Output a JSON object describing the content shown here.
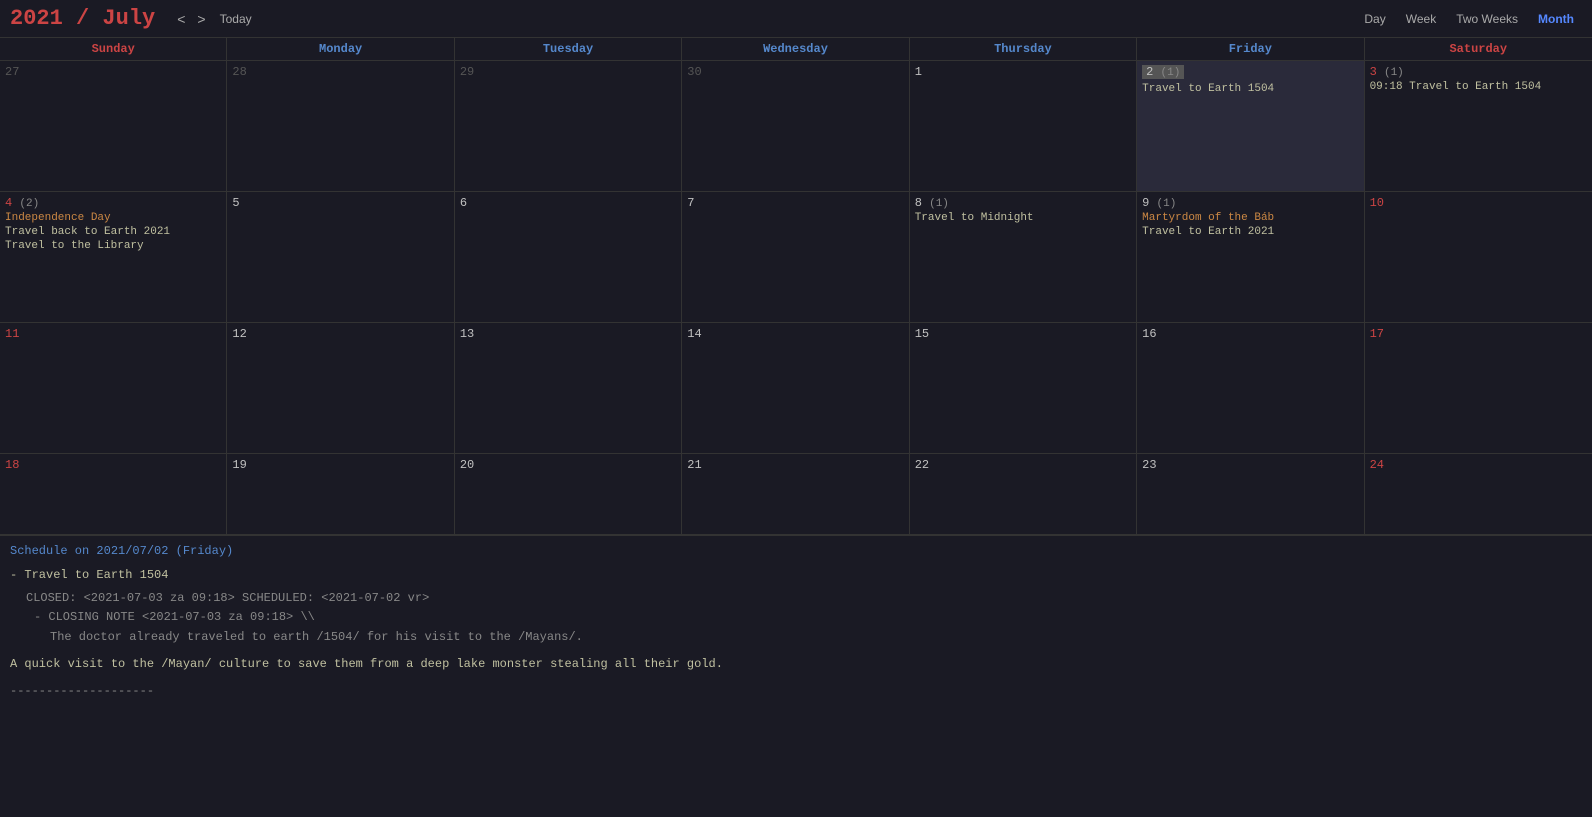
{
  "header": {
    "year": "2021",
    "slash": " / ",
    "month": "July",
    "nav_prev": "<",
    "nav_next": ">",
    "today_label": "Today",
    "views": [
      "Day",
      "Week",
      "Two Weeks",
      "Month"
    ],
    "active_view": "Month"
  },
  "day_headers": [
    {
      "label": "Sunday",
      "type": "sun"
    },
    {
      "label": "Monday",
      "type": "weekday"
    },
    {
      "label": "Tuesday",
      "type": "weekday"
    },
    {
      "label": "Wednesday",
      "type": "weekday"
    },
    {
      "label": "Thursday",
      "type": "weekday"
    },
    {
      "label": "Friday",
      "type": "weekday"
    },
    {
      "label": "Saturday",
      "type": "sat"
    }
  ],
  "weeks": [
    {
      "days": [
        {
          "num": "27",
          "badge": "",
          "type": "other",
          "events": []
        },
        {
          "num": "28",
          "badge": "",
          "type": "other",
          "events": []
        },
        {
          "num": "29",
          "badge": "",
          "type": "other",
          "events": []
        },
        {
          "num": "30",
          "badge": "",
          "type": "other",
          "events": []
        },
        {
          "num": "1",
          "badge": "",
          "type": "normal",
          "events": []
        },
        {
          "num": "2",
          "badge": "(1)",
          "type": "today",
          "events": [
            {
              "text": "Travel to Earth 1504",
              "style": "travel"
            }
          ]
        },
        {
          "num": "3",
          "badge": "(1)",
          "type": "saturday",
          "events": [
            {
              "text": "09:18 Travel to Earth 1504",
              "style": "travel"
            }
          ]
        }
      ]
    },
    {
      "days": [
        {
          "num": "4",
          "badge": "(2)",
          "type": "sunday",
          "events": [
            {
              "text": "Independence Day",
              "style": "holiday"
            },
            {
              "text": "Travel back to Earth 2021",
              "style": "travel"
            },
            {
              "text": "Travel to the Library",
              "style": "travel"
            }
          ]
        },
        {
          "num": "5",
          "badge": "",
          "type": "normal",
          "events": []
        },
        {
          "num": "6",
          "badge": "",
          "type": "normal",
          "events": []
        },
        {
          "num": "7",
          "badge": "",
          "type": "normal",
          "events": []
        },
        {
          "num": "8",
          "badge": "(1)",
          "type": "normal",
          "events": [
            {
              "text": "Travel to Midnight",
              "style": "travel"
            }
          ]
        },
        {
          "num": "9",
          "badge": "(1)",
          "type": "normal",
          "events": [
            {
              "text": "Martyrdom of the Báb",
              "style": "holiday"
            },
            {
              "text": "Travel to Earth 2021",
              "style": "travel"
            }
          ]
        },
        {
          "num": "10",
          "badge": "",
          "type": "saturday",
          "events": []
        }
      ]
    },
    {
      "days": [
        {
          "num": "11",
          "badge": "",
          "type": "sunday",
          "events": []
        },
        {
          "num": "12",
          "badge": "",
          "type": "normal",
          "events": []
        },
        {
          "num": "13",
          "badge": "",
          "type": "normal",
          "events": []
        },
        {
          "num": "14",
          "badge": "",
          "type": "normal",
          "events": []
        },
        {
          "num": "15",
          "badge": "",
          "type": "normal",
          "events": []
        },
        {
          "num": "16",
          "badge": "",
          "type": "normal",
          "events": []
        },
        {
          "num": "17",
          "badge": "",
          "type": "saturday",
          "events": []
        }
      ]
    },
    {
      "days": [
        {
          "num": "18",
          "badge": "",
          "type": "sunday",
          "events": []
        },
        {
          "num": "19",
          "badge": "",
          "type": "normal",
          "events": []
        },
        {
          "num": "20",
          "badge": "",
          "type": "normal",
          "events": []
        },
        {
          "num": "21",
          "badge": "",
          "type": "normal",
          "events": []
        },
        {
          "num": "22",
          "badge": "",
          "type": "normal",
          "events": []
        },
        {
          "num": "23",
          "badge": "",
          "type": "normal",
          "events": []
        },
        {
          "num": "24",
          "badge": "",
          "type": "saturday",
          "events": []
        }
      ]
    }
  ],
  "schedule": {
    "title": "Schedule on 2021/07/02 (Friday)",
    "items": [
      {
        "bullet": "- ",
        "name": "Travel to Earth 1504",
        "closed": "CLOSED: <2021-07-03 za 09:18> SCHEDULED: <2021-07-02 vr>",
        "closing_note_label": "- CLOSING NOTE <2021-07-03 za 09:18> \\\\",
        "note_line1": "The doctor already traveled to earth /1504/ for his visit to the /Mayans/.",
        "summary": "A quick visit to the /Mayan/ culture to save them from a deep lake monster stealing all their gold.",
        "divider": "--------------------"
      }
    ]
  }
}
